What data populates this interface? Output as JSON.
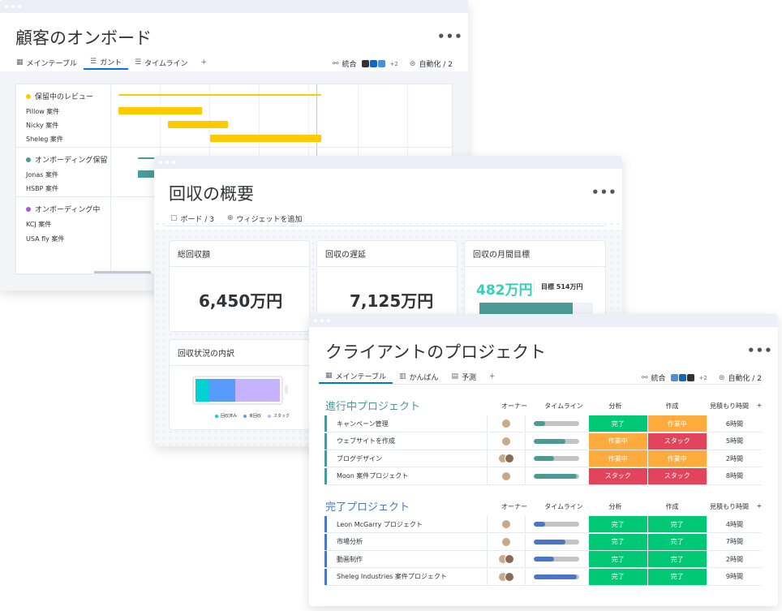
{
  "w1": {
    "title": "顧客のオンボード",
    "more": "•••",
    "tabs": [
      "メインテーブル",
      "ガント",
      "タイムライン",
      "+"
    ],
    "integration": "統合",
    "integration_count": "+2",
    "automation": "自動化 / 2",
    "groups": [
      {
        "name": "保留中のレビュー",
        "color": "#ffcb00",
        "items": [
          "Pillow 案件",
          "Nicky 案件",
          "Sheleg 案件"
        ]
      },
      {
        "name": "オンボーディング保留",
        "color": "#4a9b96",
        "items": [
          "Jonas 案件",
          "HSBP 案件"
        ]
      },
      {
        "name": "オンボーディング中",
        "color": "#a25ddc",
        "items": [
          "KCJ 案件",
          "USA fly 案件"
        ]
      }
    ]
  },
  "w2": {
    "title": "回収の概要",
    "more": "•••",
    "boards": "ボード / 3",
    "add_widget": "ウィジェットを追加",
    "cards": {
      "total": {
        "title": "総回収額",
        "value": "6,450万円"
      },
      "delay": {
        "title": "回収の遅延",
        "value": "7,125万円"
      },
      "goal": {
        "title": "回収の月間目標",
        "value": "482万円",
        "target": "目標 514万円",
        "progress": 0.82
      }
    },
    "breakdown": {
      "title": "回収状況の内訳",
      "legend": [
        "回収済み",
        "未回収",
        "スタック"
      ],
      "colors": [
        "#00d2d2",
        "#579bfc",
        "#c5b3ff"
      ],
      "fractions": [
        0.15,
        0.32,
        0.53
      ]
    }
  },
  "w3": {
    "title": "クライアントのプロジェクト",
    "more": "•••",
    "tabs": [
      "メインテーブル",
      "かんばん",
      "予測",
      "+"
    ],
    "integration": "統合",
    "integration_count": "+2",
    "automation": "自動化 / 2",
    "columns": [
      "オーナー",
      "タイムライン",
      "分析",
      "作成",
      "見積もり時間",
      "+"
    ],
    "groups": [
      {
        "name": "進行中プロジェクト",
        "color": "#579bfc",
        "rows": [
          {
            "name": "キャンペーン管理",
            "timeline": 0.25,
            "a": "完了",
            "ac": "#00c875",
            "b": "作業中",
            "bc": "#fdab3d",
            "est": "6時間"
          },
          {
            "name": "ウェブサイトを作成",
            "timeline": 0.7,
            "a": "作業中",
            "ac": "#fdab3d",
            "b": "スタック",
            "bc": "#e2445c",
            "est": "5時間"
          },
          {
            "name": "ブログデザイン",
            "timeline": 0.45,
            "a": "作業中",
            "ac": "#fdab3d",
            "b": "作業中",
            "bc": "#fdab3d",
            "est": "2時間"
          },
          {
            "name": "Moon 案件プロジェクト",
            "timeline": 0.95,
            "a": "スタック",
            "ac": "#e2445c",
            "b": "スタック",
            "bc": "#e2445c",
            "est": "8時間"
          }
        ]
      },
      {
        "name": "完了プロジェクト",
        "color": "#579bfc",
        "rows": [
          {
            "name": "Leon McGarry プロジェクト",
            "timeline": 0.25,
            "a": "完了",
            "ac": "#00c875",
            "b": "完了",
            "bc": "#00c875",
            "est": "4時間"
          },
          {
            "name": "市場分析",
            "timeline": 0.7,
            "a": "完了",
            "ac": "#00c875",
            "b": "完了",
            "bc": "#00c875",
            "est": "7時間"
          },
          {
            "name": "動画制作",
            "timeline": 0.45,
            "a": "完了",
            "ac": "#00c875",
            "b": "完了",
            "bc": "#00c875",
            "est": "2時間"
          },
          {
            "name": "Sheleg Industries 案件プロジェクト",
            "timeline": 0.95,
            "a": "完了",
            "ac": "#00c875",
            "b": "完了",
            "bc": "#00c875",
            "est": "9時間"
          }
        ]
      }
    ]
  }
}
